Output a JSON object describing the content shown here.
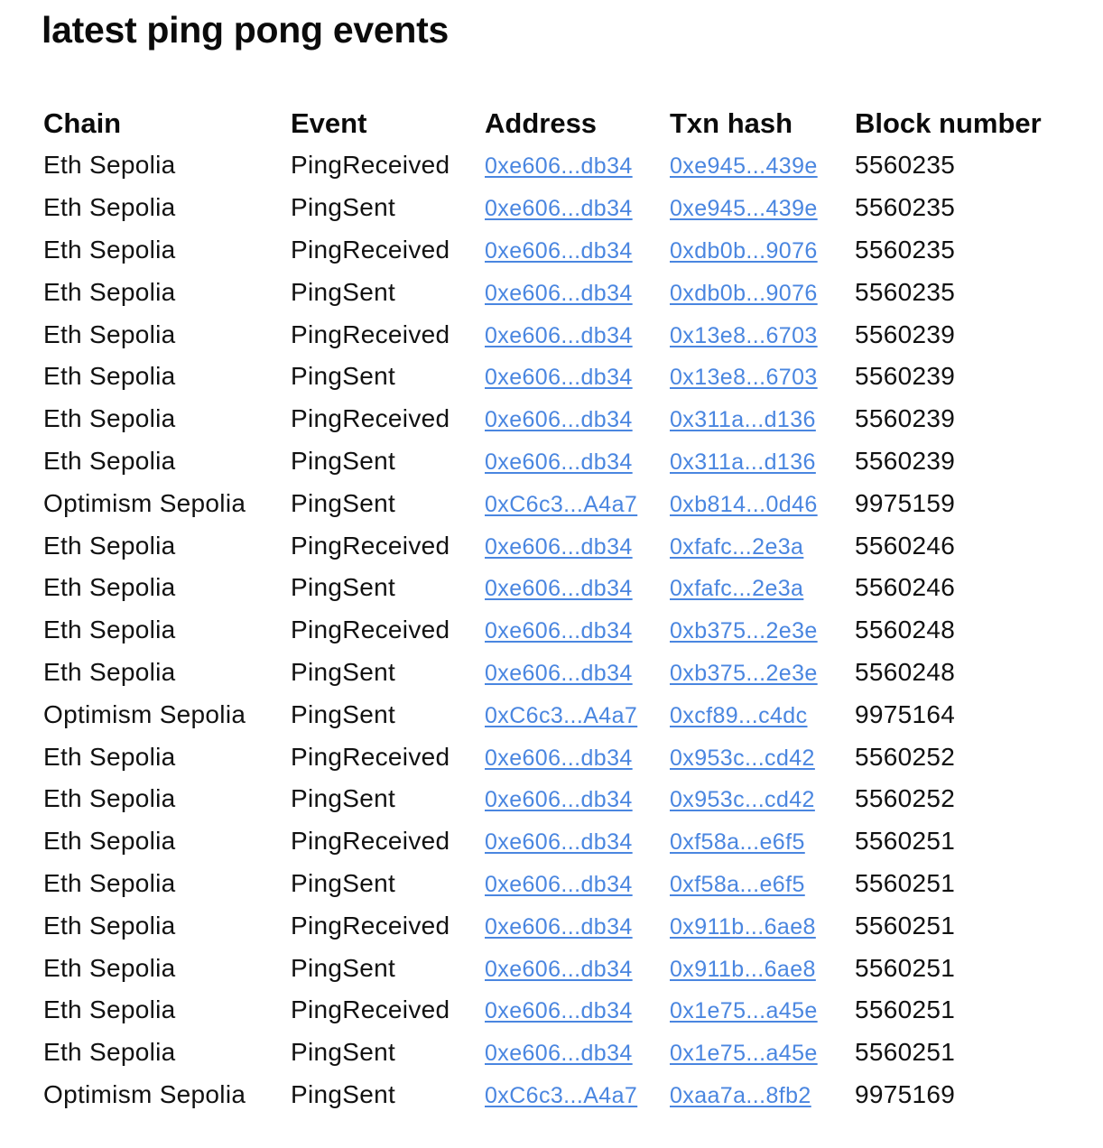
{
  "page": {
    "title": "latest ping pong events"
  },
  "table": {
    "headers": {
      "chain": "Chain",
      "event": "Event",
      "address": "Address",
      "txn_hash": "Txn hash",
      "block_number": "Block number"
    },
    "rows": [
      {
        "chain": "Eth Sepolia",
        "event": "PingReceived",
        "address": "0xe606...db34",
        "txn_hash": "0xe945...439e",
        "block_number": "5560235"
      },
      {
        "chain": "Eth Sepolia",
        "event": "PingSent",
        "address": "0xe606...db34",
        "txn_hash": "0xe945...439e",
        "block_number": "5560235"
      },
      {
        "chain": "Eth Sepolia",
        "event": "PingReceived",
        "address": "0xe606...db34",
        "txn_hash": "0xdb0b...9076",
        "block_number": "5560235"
      },
      {
        "chain": "Eth Sepolia",
        "event": "PingSent",
        "address": "0xe606...db34",
        "txn_hash": "0xdb0b...9076",
        "block_number": "5560235"
      },
      {
        "chain": "Eth Sepolia",
        "event": "PingReceived",
        "address": "0xe606...db34",
        "txn_hash": "0x13e8...6703",
        "block_number": "5560239"
      },
      {
        "chain": "Eth Sepolia",
        "event": "PingSent",
        "address": "0xe606...db34",
        "txn_hash": "0x13e8...6703",
        "block_number": "5560239"
      },
      {
        "chain": "Eth Sepolia",
        "event": "PingReceived",
        "address": "0xe606...db34",
        "txn_hash": "0x311a...d136",
        "block_number": "5560239"
      },
      {
        "chain": "Eth Sepolia",
        "event": "PingSent",
        "address": "0xe606...db34",
        "txn_hash": "0x311a...d136",
        "block_number": "5560239"
      },
      {
        "chain": "Optimism Sepolia",
        "event": "PingSent",
        "address": "0xC6c3...A4a7",
        "txn_hash": "0xb814...0d46",
        "block_number": "9975159"
      },
      {
        "chain": "Eth Sepolia",
        "event": "PingReceived",
        "address": "0xe606...db34",
        "txn_hash": "0xfafc...2e3a",
        "block_number": "5560246"
      },
      {
        "chain": "Eth Sepolia",
        "event": "PingSent",
        "address": "0xe606...db34",
        "txn_hash": "0xfafc...2e3a",
        "block_number": "5560246"
      },
      {
        "chain": "Eth Sepolia",
        "event": "PingReceived",
        "address": "0xe606...db34",
        "txn_hash": "0xb375...2e3e",
        "block_number": "5560248"
      },
      {
        "chain": "Eth Sepolia",
        "event": "PingSent",
        "address": "0xe606...db34",
        "txn_hash": "0xb375...2e3e",
        "block_number": "5560248"
      },
      {
        "chain": "Optimism Sepolia",
        "event": "PingSent",
        "address": "0xC6c3...A4a7",
        "txn_hash": "0xcf89...c4dc",
        "block_number": "9975164"
      },
      {
        "chain": "Eth Sepolia",
        "event": "PingReceived",
        "address": "0xe606...db34",
        "txn_hash": "0x953c...cd42",
        "block_number": "5560252"
      },
      {
        "chain": "Eth Sepolia",
        "event": "PingSent",
        "address": "0xe606...db34",
        "txn_hash": "0x953c...cd42",
        "block_number": "5560252"
      },
      {
        "chain": "Eth Sepolia",
        "event": "PingReceived",
        "address": "0xe606...db34",
        "txn_hash": "0xf58a...e6f5",
        "block_number": "5560251"
      },
      {
        "chain": "Eth Sepolia",
        "event": "PingSent",
        "address": "0xe606...db34",
        "txn_hash": "0xf58a...e6f5",
        "block_number": "5560251"
      },
      {
        "chain": "Eth Sepolia",
        "event": "PingReceived",
        "address": "0xe606...db34",
        "txn_hash": "0x911b...6ae8",
        "block_number": "5560251"
      },
      {
        "chain": "Eth Sepolia",
        "event": "PingSent",
        "address": "0xe606...db34",
        "txn_hash": "0x911b...6ae8",
        "block_number": "5560251"
      },
      {
        "chain": "Eth Sepolia",
        "event": "PingReceived",
        "address": "0xe606...db34",
        "txn_hash": "0x1e75...a45e",
        "block_number": "5560251"
      },
      {
        "chain": "Eth Sepolia",
        "event": "PingSent",
        "address": "0xe606...db34",
        "txn_hash": "0x1e75...a45e",
        "block_number": "5560251"
      },
      {
        "chain": "Optimism Sepolia",
        "event": "PingSent",
        "address": "0xC6c3...A4a7",
        "txn_hash": "0xaa7a...8fb2",
        "block_number": "9975169"
      }
    ]
  },
  "colors": {
    "link": "#4a86e0",
    "text": "#111111",
    "background": "#ffffff"
  }
}
